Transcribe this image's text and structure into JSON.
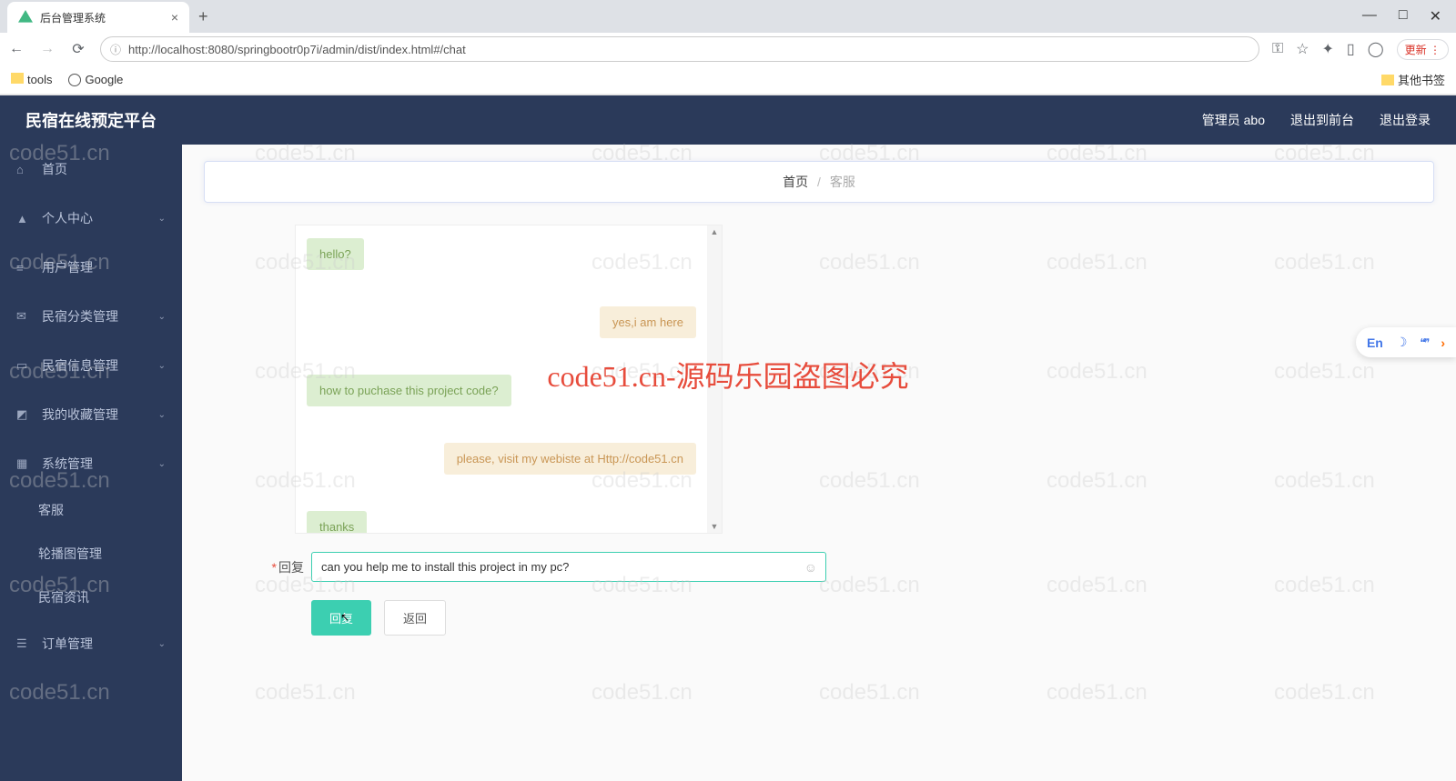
{
  "browser": {
    "tab_title": "后台管理系统",
    "new_tab": "+",
    "close": "×",
    "min": "—",
    "max": "□",
    "win_close": "✕",
    "url": "http://localhost:8080/springbootr0p7i/admin/dist/index.html#/chat",
    "info_icon": "ⓘ",
    "update_label": "更新",
    "bookmarks": {
      "tools": "tools",
      "google": "Google",
      "other": "其他书签"
    }
  },
  "header": {
    "brand": "民宿在线预定平台",
    "admin": "管理员 abo",
    "exit_front": "退出到前台",
    "logout": "退出登录"
  },
  "sidebar": {
    "items": [
      {
        "label": "首页",
        "icon": "⌂"
      },
      {
        "label": "个人中心",
        "icon": "▲",
        "chev": true
      },
      {
        "label": "用户管理",
        "icon": "≡"
      },
      {
        "label": "民宿分类管理",
        "icon": "✉",
        "chev": true
      },
      {
        "label": "民宿信息管理",
        "icon": "▭",
        "chev": true
      },
      {
        "label": "我的收藏管理",
        "icon": "◩",
        "chev": true
      },
      {
        "label": "系统管理",
        "icon": "▦",
        "chev": true
      },
      {
        "label": "订单管理",
        "icon": "☰",
        "chev": true
      }
    ],
    "subs": [
      {
        "label": "客服"
      },
      {
        "label": "轮播图管理"
      },
      {
        "label": "民宿资讯"
      }
    ]
  },
  "breadcrumb": {
    "home": "首页",
    "sep": "/",
    "current": "客服"
  },
  "chat": {
    "messages": [
      {
        "side": "left",
        "color": "green",
        "text": "hello?"
      },
      {
        "side": "right",
        "color": "orange",
        "text": "yes,i am here"
      },
      {
        "side": "left",
        "color": "green",
        "text": "how to puchase this project code?"
      },
      {
        "side": "right",
        "color": "orange",
        "text": "please, visit my webiste at Http://code51.cn"
      },
      {
        "side": "left",
        "color": "green",
        "text": "thanks"
      }
    ]
  },
  "form": {
    "label": "回复",
    "value": "can you help me to install this project in my pc?",
    "submit": "回复",
    "back": "返回"
  },
  "lang_widget": {
    "en": "En",
    "moon": "☽",
    "quotes": "❝❞",
    "arrow": "›"
  },
  "watermark": {
    "text": "code51.cn",
    "big": "code51.cn-源码乐园盗图必究"
  }
}
